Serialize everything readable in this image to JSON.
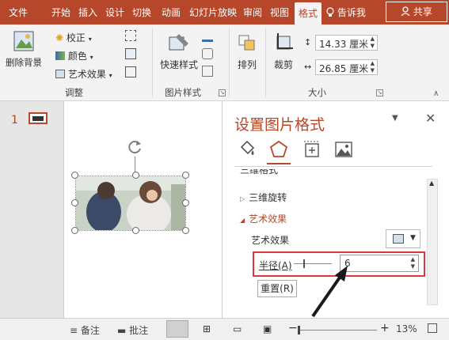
{
  "tabs": [
    {
      "label": "文件",
      "active": false
    },
    {
      "label": "开始",
      "active": false
    },
    {
      "label": "插入",
      "active": false
    },
    {
      "label": "设计",
      "active": false
    },
    {
      "label": "切换",
      "active": false
    },
    {
      "label": "动画",
      "active": false
    },
    {
      "label": "幻灯片放映",
      "active": false
    },
    {
      "label": "审阅",
      "active": false
    },
    {
      "label": "视图",
      "active": false
    },
    {
      "label": "格式",
      "active": true
    }
  ],
  "tell_me": "告诉我",
  "share": "共享",
  "ribbon": {
    "remove_bg": "删除背景",
    "correct": "校正",
    "color": "颜色",
    "art_effects": "艺术效果",
    "adjust_group": "调整",
    "quick_styles": "快速样式",
    "pic_styles_group": "图片样式",
    "arrange": "排列",
    "crop": "裁剪",
    "size_group": "大小",
    "height": "14.33 厘米",
    "width": "26.85 厘米"
  },
  "slide_number": "1",
  "pane": {
    "title": "设置图片格式",
    "cut_section": "三维格式",
    "sec_3d_rotate": "三维旋转",
    "sec_art": "艺术效果",
    "art_label": "艺术效果",
    "radius_label": "半径(A)",
    "radius_value": "6",
    "reset": "重置(R)"
  },
  "status": {
    "notes": "备注",
    "comments": "批注",
    "zoom": "13%"
  },
  "colors": {
    "accent": "#b7472a",
    "highlight": "#d9363e"
  }
}
